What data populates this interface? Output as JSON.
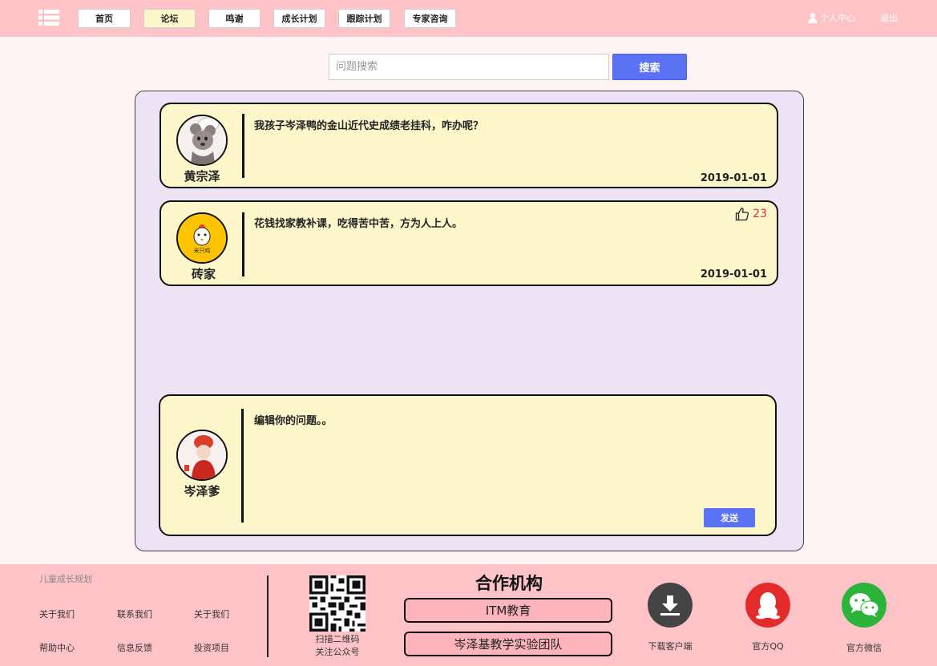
{
  "nav": {
    "items": [
      {
        "label": "首页",
        "active": false
      },
      {
        "label": "论坛",
        "active": true
      },
      {
        "label": "鸣谢",
        "active": false
      },
      {
        "label": "成长计划",
        "active": false
      },
      {
        "label": "跟踪计划",
        "active": false
      },
      {
        "label": "专家咨询",
        "active": false
      }
    ],
    "user_center": "个人中心",
    "logout": "退出"
  },
  "search": {
    "placeholder": "问题搜索",
    "button": "搜索"
  },
  "posts": [
    {
      "author": "黄宗泽",
      "text": "我孩子岑泽鸭的金山近代史成绩老挂科，咋办呢？",
      "date": "2019-01-01"
    },
    {
      "author": "砖家",
      "avatar_text": "米只鸡",
      "text": "花钱找家教补课，吃得苦中苦，方为人上人。",
      "date": "2019-01-01",
      "likes": "23"
    }
  ],
  "compose": {
    "author": "岑泽爹",
    "placeholder": "编辑你的问题。。",
    "send": "发送"
  },
  "footer": {
    "title": "儿童成长规划",
    "links": [
      "关于我们",
      "联系我们",
      "关于我们",
      "帮助中心",
      "信息反馈",
      "投资项目"
    ],
    "qr_text_1": "扫描二维码",
    "qr_text_2": "关注公众号",
    "coop_title": "合作机构",
    "coop_1": "ITM教育",
    "coop_2": "岑泽基教学实验团队",
    "download": "下载客户端",
    "qq": "官方QQ",
    "wechat": "官方微信"
  },
  "colors": {
    "topbar": "#ffc3c8",
    "accent_button": "#5b72f5",
    "card": "#fff7cc",
    "panel": "#ece4f4",
    "qq": "#e32b2b",
    "wechat": "#2bb33a",
    "download": "#444444"
  },
  "icons": [
    "menu-icon",
    "user-icon",
    "thumbs-up-icon",
    "download-icon",
    "qq-icon",
    "wechat-icon",
    "qr-code"
  ]
}
